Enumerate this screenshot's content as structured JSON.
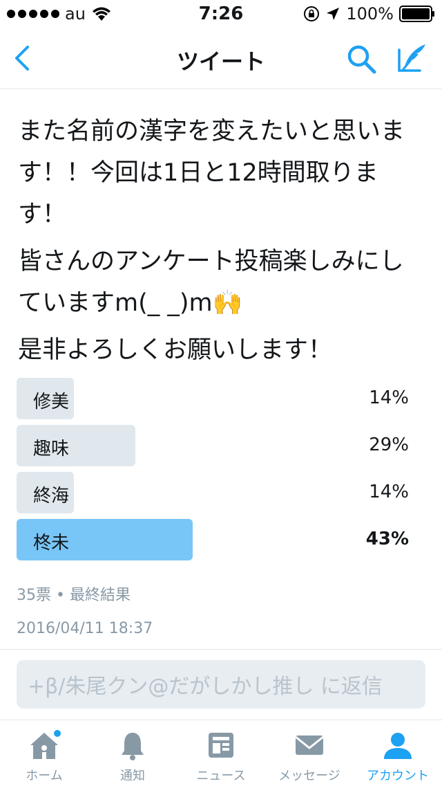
{
  "status_bar": {
    "carrier": "au",
    "time": "7:26",
    "battery": "100%"
  },
  "nav": {
    "title": "ツイート"
  },
  "tweet": {
    "paragraphs": [
      "また名前の漢字を変えたいと思います！！今回は1日と12時間取ります！",
      "皆さんのアンケート投稿楽しみにしていますm(_ _)m🙌",
      "是非よろしくお願いします！"
    ],
    "timestamp": "2016/04/11 18:37"
  },
  "poll": {
    "options": [
      {
        "label": "修美",
        "percent_text": "14%",
        "percent": 14,
        "winner": false
      },
      {
        "label": "趣味",
        "percent_text": "29%",
        "percent": 29,
        "winner": false
      },
      {
        "label": "終海",
        "percent_text": "14%",
        "percent": 14,
        "winner": false
      },
      {
        "label": "柊未",
        "percent_text": "43%",
        "percent": 43,
        "winner": true
      }
    ],
    "meta": "35票 • 最終結果"
  },
  "reply": {
    "placeholder": "+β/朱尾クン@だがしかし推し に返信"
  },
  "tabs": [
    {
      "label": "ホーム",
      "icon": "home-icon",
      "active": false
    },
    {
      "label": "通知",
      "icon": "bell-icon",
      "active": false
    },
    {
      "label": "ニュース",
      "icon": "news-icon",
      "active": false
    },
    {
      "label": "メッセージ",
      "icon": "envelope-icon",
      "active": false
    },
    {
      "label": "アカウント",
      "icon": "person-icon",
      "active": true
    }
  ],
  "colors": {
    "accent": "#1da1f2",
    "poll_bar": "#e1e8ed",
    "poll_winner": "#78c5f7",
    "muted": "#8899a6"
  }
}
